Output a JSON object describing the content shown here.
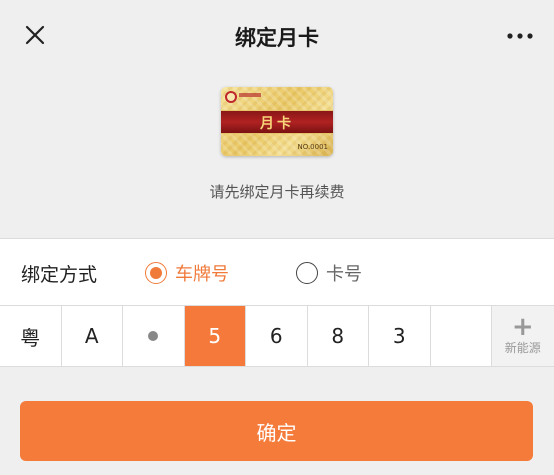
{
  "header": {
    "title": "绑定月卡"
  },
  "card": {
    "label": "月卡",
    "number": "NO.0001"
  },
  "hint": "请先绑定月卡再续费",
  "binding": {
    "label": "绑定方式",
    "options": [
      {
        "label": "车牌号",
        "selected": true
      },
      {
        "label": "卡号",
        "selected": false
      }
    ]
  },
  "plate": {
    "cells": [
      "粤",
      "A",
      "•",
      "5",
      "6",
      "8",
      "3",
      ""
    ],
    "active_index": 3,
    "new_energy_label": "新能源"
  },
  "confirm_label": "确定",
  "colors": {
    "accent": "#f57b3a",
    "background": "#efefef"
  }
}
